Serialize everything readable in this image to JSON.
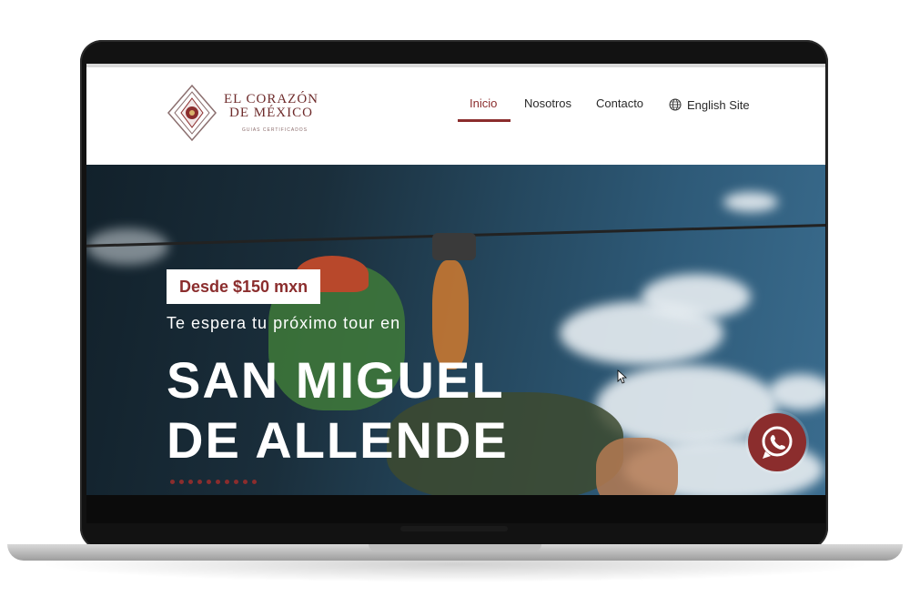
{
  "logo": {
    "line1": "EL CORAZÓN",
    "line2": "DE MÉXICO",
    "tagline": "GUIAS CERTIFICADOS"
  },
  "nav": {
    "items": [
      {
        "label": "Inicio",
        "active": true
      },
      {
        "label": "Nosotros",
        "active": false
      },
      {
        "label": "Contacto",
        "active": false
      }
    ],
    "language": {
      "label": "English Site",
      "icon": "globe-icon"
    }
  },
  "hero": {
    "price_badge": "Desde $150 mxn",
    "subtitle": "Te espera tu próximo tour en",
    "title_line1": "SAN MIGUEL",
    "title_line2": "DE ALLENDE",
    "slider_dots": 10
  },
  "floating": {
    "whatsapp_icon": "whatsapp-icon"
  },
  "colors": {
    "brand": "#8b2d2d",
    "nav_text": "#2a2a2a",
    "hero_text": "#ffffff"
  }
}
